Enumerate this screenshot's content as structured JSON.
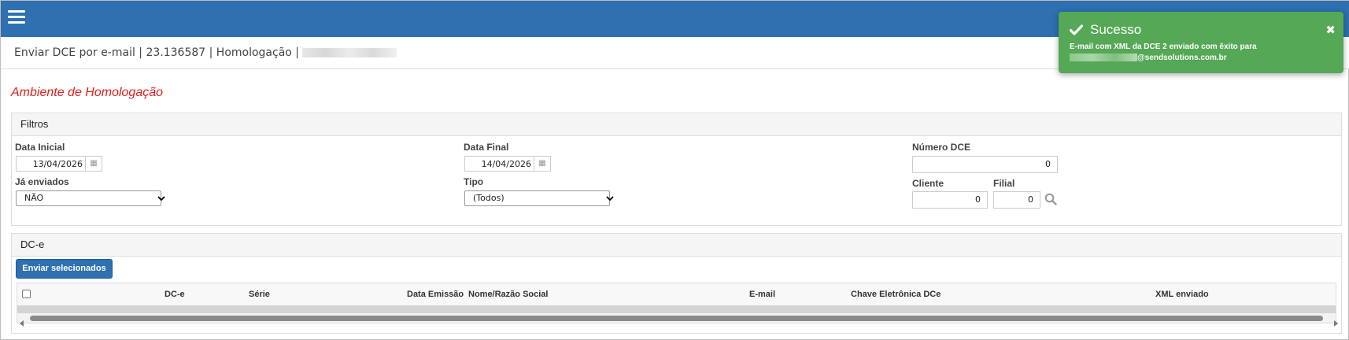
{
  "header": {
    "breadcrumb": "Enviar DCE por e-mail | 23.136587 | Homologação |"
  },
  "environment_title": "Ambiente de Homologação",
  "filters": {
    "title": "Filtros",
    "data_inicial": {
      "label": "Data Inicial",
      "value": "13/04/2026"
    },
    "data_final": {
      "label": "Data Final",
      "value": "14/04/2026"
    },
    "numero_dce": {
      "label": "Número DCE",
      "value": "0"
    },
    "ja_enviados": {
      "label": "Já enviados",
      "selected": "NÃO"
    },
    "tipo": {
      "label": "Tipo",
      "selected": "(Todos)"
    },
    "cliente": {
      "label": "Cliente",
      "value": "0"
    },
    "filial": {
      "label": "Filial",
      "value": "0"
    }
  },
  "dce_panel": {
    "title": "DC-e",
    "send_button": "Enviar selecionados",
    "columns": [
      "DC-e",
      "Série",
      "Data Emissão",
      "Nome/Razão Social",
      "E-mail",
      "Chave Eletrônica DCe",
      "XML enviado"
    ]
  },
  "toast": {
    "title": "Sucesso",
    "message_line1": "E-mail com XML da DCE 2 enviado com êxito para",
    "message_line2_suffix": "@sendsolutions.com.br",
    "color": "#55a855"
  },
  "colors": {
    "topbar": "#2e70b0",
    "env_title": "#e02020"
  }
}
